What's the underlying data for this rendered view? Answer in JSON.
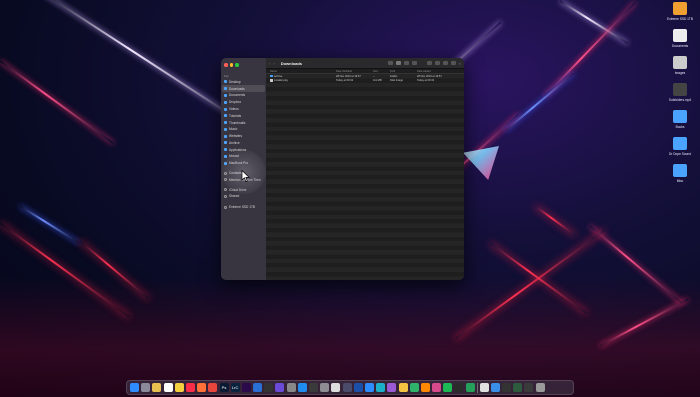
{
  "desktop": {
    "icons": [
      {
        "label": "Extreme SSD 1TB",
        "icon": "drive-icon",
        "color": "#f0a030"
      },
      {
        "label": "Documents",
        "icon": "document-icon",
        "color": "#eeeeee"
      },
      {
        "label": "Images",
        "icon": "image-icon",
        "color": "#cccccc"
      },
      {
        "label": "Subfolders.mp4",
        "icon": "video-icon",
        "color": "#444444"
      },
      {
        "label": "Books",
        "icon": "folder-icon",
        "color": "#4aa3ff"
      },
      {
        "label": "Dr Dope Sound",
        "icon": "folder-icon",
        "color": "#4aa3ff"
      },
      {
        "label": "Misc",
        "icon": "folder-icon",
        "color": "#4aa3ff"
      }
    ]
  },
  "finder": {
    "title": "Downloads",
    "sidebar": {
      "favorites_heading": "Fav",
      "items": [
        {
          "label": "Desktop",
          "active": false
        },
        {
          "label": "Downloads",
          "active": true
        },
        {
          "label": "Documents",
          "active": false
        },
        {
          "label": "Dropbox",
          "active": false
        },
        {
          "label": "Videos",
          "active": false
        },
        {
          "label": "Tutorials",
          "active": false
        },
        {
          "label": "Thumbnails",
          "active": false
        },
        {
          "label": "Music",
          "active": false
        },
        {
          "label": "Websites",
          "active": false
        },
        {
          "label": "Archive",
          "active": false
        },
        {
          "label": "Applications",
          "active": false
        },
        {
          "label": "Movavi",
          "active": false
        },
        {
          "label": "MacBook Pro",
          "active": false
        }
      ],
      "tags_items": [
        {
          "label": "Contacts"
        },
        {
          "label": "Mention Mention Then"
        }
      ],
      "icloud_items": [
        {
          "label": "iCloud Drive"
        },
        {
          "label": "Shared"
        }
      ],
      "locations_items": [
        {
          "label": "Extreme SSD 1TB"
        }
      ]
    },
    "columns": {
      "name": "Name",
      "modified": "Date Modified",
      "size": "Size",
      "kind": "Kind",
      "date_added": "Date Added"
    },
    "files": [
      {
        "name": "archive",
        "modified": "28 Nov 2023 at 19:57",
        "size": "--",
        "kind": "Folder",
        "date_added": "28 Nov 2023 at 19:57",
        "icon": "folder-icon",
        "color": "#4aa3ff"
      },
      {
        "name": "installer.pkg",
        "modified": "Today at 09:43",
        "size": "111 MB",
        "kind": "Disk Image",
        "date_added": "Today at 09:43",
        "icon": "package-icon",
        "color": "#cfcfcf"
      }
    ]
  },
  "dock": {
    "apps": [
      {
        "name": "finder",
        "color": "#2f8cff",
        "glyph": ""
      },
      {
        "name": "launchpad",
        "color": "#8a8a9a",
        "glyph": ""
      },
      {
        "name": "photos",
        "color": "#e8c050",
        "glyph": ""
      },
      {
        "name": "calendar",
        "color": "#ffffff",
        "glyph": ""
      },
      {
        "name": "notes",
        "color": "#f4d03f",
        "glyph": ""
      },
      {
        "name": "music",
        "color": "#fa2d48",
        "glyph": ""
      },
      {
        "name": "firefox",
        "color": "#ff7139",
        "glyph": ""
      },
      {
        "name": "chrome",
        "color": "#e8453c",
        "glyph": ""
      },
      {
        "name": "photoshop",
        "color": "#0b1a33",
        "glyph": "Ps"
      },
      {
        "name": "lrc",
        "color": "#0a2440",
        "glyph": "LrC"
      },
      {
        "name": "premiere",
        "color": "#2a0a4a",
        "glyph": ""
      },
      {
        "name": "app-blue",
        "color": "#2a6fd6",
        "glyph": ""
      },
      {
        "name": "app-dark",
        "color": "#333333",
        "glyph": ""
      },
      {
        "name": "app-multi",
        "color": "#6a4ad6",
        "glyph": ""
      },
      {
        "name": "app-gray",
        "color": "#888888",
        "glyph": ""
      },
      {
        "name": "app-store",
        "color": "#1f8cf0",
        "glyph": ""
      },
      {
        "name": "app-dark2",
        "color": "#3a3a3a",
        "glyph": ""
      },
      {
        "name": "system-settings",
        "color": "#8d8d93",
        "glyph": ""
      },
      {
        "name": "app-light",
        "color": "#dddddd",
        "glyph": ""
      },
      {
        "name": "app-lines",
        "color": "#4a4a6a",
        "glyph": ""
      },
      {
        "name": "app-blue2",
        "color": "#1c4fa8",
        "glyph": ""
      },
      {
        "name": "zoom",
        "color": "#2d8cff",
        "glyph": ""
      },
      {
        "name": "app-teal",
        "color": "#1bb0c8",
        "glyph": ""
      },
      {
        "name": "app-purple",
        "color": "#9b59d6",
        "glyph": ""
      },
      {
        "name": "app-yellow",
        "color": "#f5c542",
        "glyph": ""
      },
      {
        "name": "app-green",
        "color": "#2fb36b",
        "glyph": ""
      },
      {
        "name": "vlc",
        "color": "#ff8800",
        "glyph": ""
      },
      {
        "name": "app-pink",
        "color": "#d64a8c",
        "glyph": ""
      },
      {
        "name": "spotify",
        "color": "#1db954",
        "glyph": ""
      },
      {
        "name": "app-dark3",
        "color": "#2b2b2b",
        "glyph": ""
      },
      {
        "name": "app-green2",
        "color": "#25a05a",
        "glyph": ""
      }
    ],
    "recents": [
      {
        "name": "doc",
        "color": "#e0e0e0",
        "glyph": ""
      },
      {
        "name": "downloads-stack",
        "color": "#3a8fe8",
        "glyph": ""
      },
      {
        "name": "screen-1",
        "color": "#333333",
        "glyph": ""
      },
      {
        "name": "screen-2",
        "color": "#2e5a3e",
        "glyph": ""
      },
      {
        "name": "screen-3",
        "color": "#3a3a3a",
        "glyph": ""
      },
      {
        "name": "trash",
        "color": "#9a9a9a",
        "glyph": ""
      }
    ]
  }
}
